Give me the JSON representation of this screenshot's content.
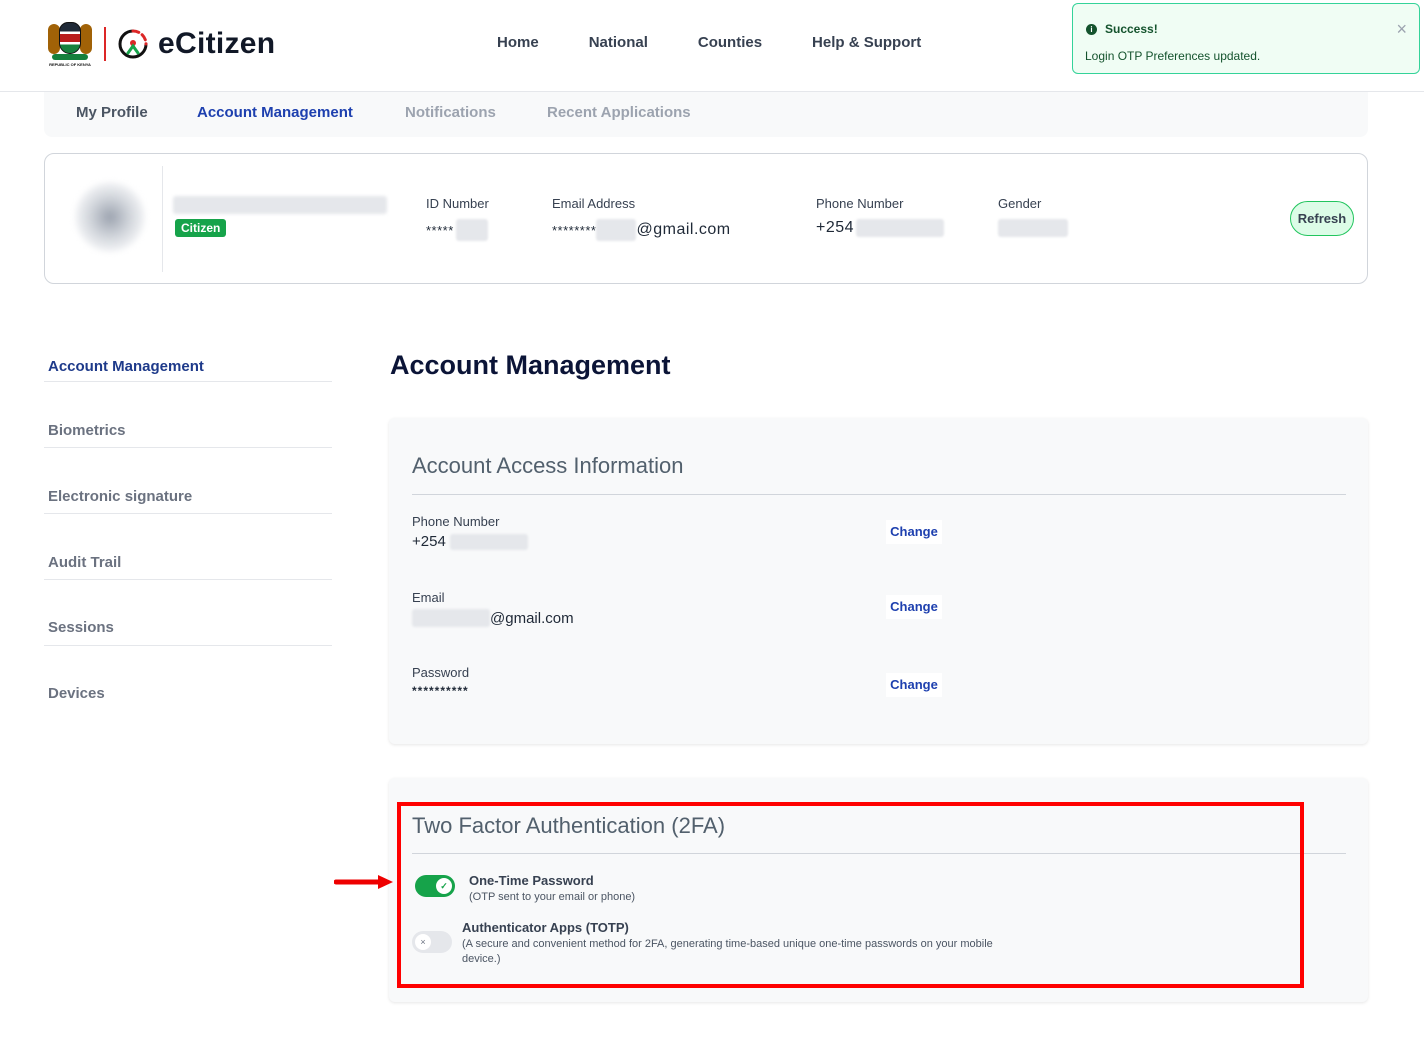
{
  "header": {
    "coat_caption": "REPUBLIC OF KENYA",
    "brand": "eCitizen",
    "nav": [
      "Home",
      "National",
      "Counties",
      "Help & Support"
    ]
  },
  "toast": {
    "icon": "info-icon",
    "title": "Success!",
    "message": "Login OTP Preferences updated.",
    "close": "×"
  },
  "tabs": [
    {
      "label": "My Profile",
      "state": "default"
    },
    {
      "label": "Account Management",
      "state": "active"
    },
    {
      "label": "Notifications",
      "state": "muted"
    },
    {
      "label": "Recent Applications",
      "state": "muted"
    }
  ],
  "profile": {
    "badge": "Citizen",
    "id_label": "ID Number",
    "id_value": "*****",
    "email_label": "Email Address",
    "email_prefix": "********",
    "email_suffix": "@gmail.com",
    "phone_label": "Phone Number",
    "phone_value": "+254",
    "gender_label": "Gender",
    "refresh": "Refresh"
  },
  "sidebar": {
    "items": [
      {
        "label": "Account Management",
        "active": true
      },
      {
        "label": "Biometrics",
        "active": false
      },
      {
        "label": "Electronic signature",
        "active": false
      },
      {
        "label": "Audit Trail",
        "active": false
      },
      {
        "label": "Sessions",
        "active": false
      },
      {
        "label": "Devices",
        "active": false
      }
    ]
  },
  "main": {
    "title": "Account Management",
    "access": {
      "title": "Account Access Information",
      "phone_label": "Phone Number",
      "phone_value": "+254",
      "email_label": "Email",
      "email_value": "@gmail.com",
      "password_label": "Password",
      "password_value": "**********",
      "change": "Change"
    },
    "twofa": {
      "title": "Two Factor Authentication (2FA)",
      "otp_title": "One-Time Password",
      "otp_desc": "(OTP sent to your email or phone)",
      "otp_enabled": true,
      "totp_title": "Authenticator Apps (TOTP)",
      "totp_desc": "(A secure and convenient method for 2FA, generating time-based unique one-time passwords on your mobile device.)",
      "totp_enabled": false
    }
  },
  "colors": {
    "active_tab": "#1e40af",
    "muted_tab": "#9ca3af",
    "toggle_on": "#16a34a",
    "highlight": "#ff0000"
  }
}
